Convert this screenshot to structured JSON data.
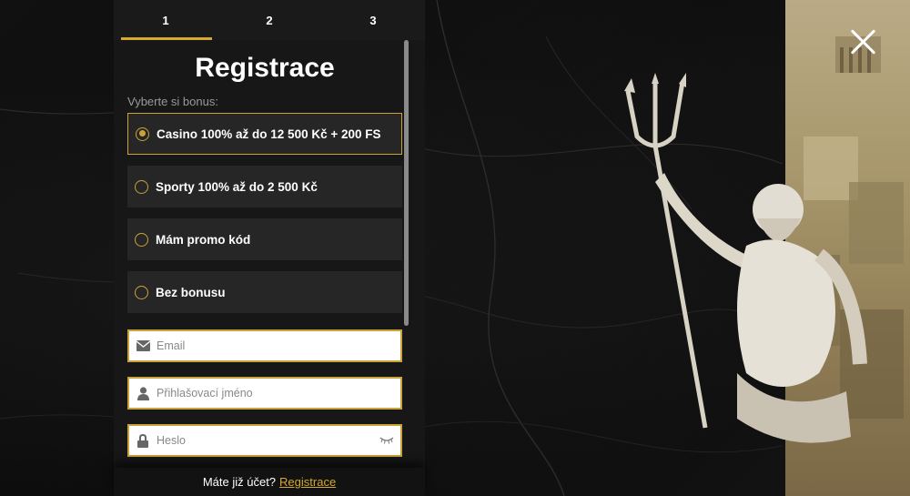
{
  "steps": [
    "1",
    "2",
    "3"
  ],
  "active_step": "1",
  "title": "Registrace",
  "bonus_label": "Vyberte si bonus:",
  "bonus_options": [
    {
      "label": "Casino 100% až do 12 500 Kč + 200 FS",
      "selected": true
    },
    {
      "label": "Sporty 100% až do 2 500 Kč",
      "selected": false
    },
    {
      "label": "Mám promo kód",
      "selected": false
    },
    {
      "label": "Bez bonusu",
      "selected": false
    }
  ],
  "fields": {
    "email_placeholder": "Email",
    "username_placeholder": "Přihlašovací jméno",
    "password_placeholder": "Heslo"
  },
  "footer": {
    "prompt": "Máte již účet?",
    "link": "Registrace"
  },
  "colors": {
    "accent": "#d4a92d",
    "panel": "#171717",
    "option": "#262626"
  }
}
